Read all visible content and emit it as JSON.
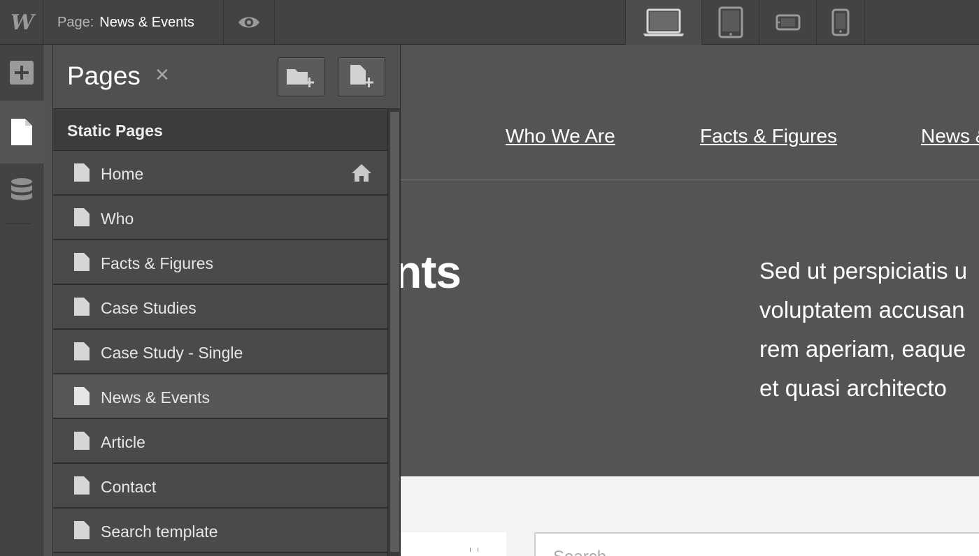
{
  "app": {
    "logo": "W"
  },
  "topbar": {
    "page_prefix": "Page:",
    "page_name": "News & Events",
    "preview_icon": "eye-icon",
    "devices": [
      "desktop-icon",
      "tablet-icon",
      "tablet-landscape-icon",
      "phone-icon"
    ],
    "active_device": "desktop"
  },
  "rail": {
    "items": [
      {
        "icon": "add-icon"
      },
      {
        "icon": "pages-icon",
        "active": true
      },
      {
        "icon": "cms-database-icon"
      }
    ]
  },
  "panel": {
    "title": "Pages",
    "close_symbol": "×",
    "add_folder_icon": "folder-add-icon",
    "add_page_icon": "page-add-icon",
    "section": "Static Pages",
    "pages": [
      {
        "label": "Home",
        "home": true
      },
      {
        "label": "Who"
      },
      {
        "label": "Facts & Figures"
      },
      {
        "label": "Case Studies"
      },
      {
        "label": "Case Study - Single"
      },
      {
        "label": "News & Events",
        "active": true
      },
      {
        "label": "Article"
      },
      {
        "label": "Contact"
      },
      {
        "label": "Search template"
      }
    ]
  },
  "canvas": {
    "nav": [
      "Who We Are",
      "Facts & Figures",
      "News &"
    ],
    "hero_title": "nts",
    "hero_lines": [
      "Sed ut perspiciatis u",
      "voluptatem accusan",
      "rem aperiam, eaque",
      "et quasi architecto"
    ],
    "search_placeholder": "Search"
  },
  "colors": {
    "chrome": "#434343",
    "panel": "#464646",
    "canvas": "#545454",
    "text": "#ffffff"
  }
}
